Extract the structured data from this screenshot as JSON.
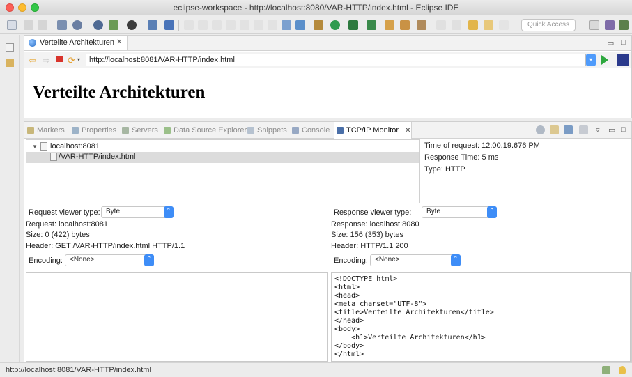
{
  "window": {
    "title": "eclipse-workspace - http://localhost:8080/VAR-HTTP/index.html - Eclipse IDE"
  },
  "toolbar": {
    "quick_access_placeholder": "Quick Access"
  },
  "editor": {
    "tab_label": "Verteilte Architekturen",
    "url": "http://localhost:8081/VAR-HTTP/index.html",
    "page_heading": "Verteilte Architekturen"
  },
  "views": {
    "tabs": [
      {
        "label": "Markers",
        "icon": "markers-icon",
        "color": "#c8b77a"
      },
      {
        "label": "Properties",
        "icon": "properties-icon",
        "color": "#9db3c8"
      },
      {
        "label": "Servers",
        "icon": "servers-icon",
        "color": "#a7b7a3"
      },
      {
        "label": "Data Source Explorer",
        "icon": "data-source-icon",
        "color": "#9bc08a"
      },
      {
        "label": "Snippets",
        "icon": "snippets-icon",
        "color": "#b6c2d0"
      },
      {
        "label": "Console",
        "icon": "console-icon",
        "color": "#98a9c4"
      },
      {
        "label": "TCP/IP Monitor",
        "icon": "tcpip-monitor-icon",
        "color": "#4a6fa8"
      }
    ]
  },
  "monitor": {
    "tree": {
      "host": "localhost:8081",
      "request_path": "/VAR-HTTP/index.html"
    },
    "info": {
      "time": "Time of request: 12:00.19.676 PM",
      "response_time": "Response Time: 5 ms",
      "type": "Type: HTTP"
    },
    "request": {
      "viewer_label": "Request viewer type:",
      "viewer_value": "Byte",
      "request_line": "Request: localhost:8081",
      "size": "Size: 0 (422) bytes",
      "header": "Header: GET /VAR-HTTP/index.html HTTP/1.1",
      "encoding_label": "Encoding:",
      "encoding_value": "<None>"
    },
    "response": {
      "viewer_label": "Response viewer type:",
      "viewer_value": "Byte",
      "response_line": "Response: localhost:8080",
      "size": "Size: 156 (353) bytes",
      "header": "Header: HTTP/1.1 200",
      "encoding_label": "Encoding:",
      "encoding_value": "<None>",
      "body": "<!DOCTYPE html>\n<html>\n<head>\n<meta charset=\"UTF-8\">\n<title>Verteilte Architekturen</title>\n</head>\n<body>\n    <h1>Verteilte Architekturen</h1>\n</body>\n</html>"
    }
  },
  "statusbar": {
    "text": "http://localhost:8081/VAR-HTTP/index.html"
  }
}
